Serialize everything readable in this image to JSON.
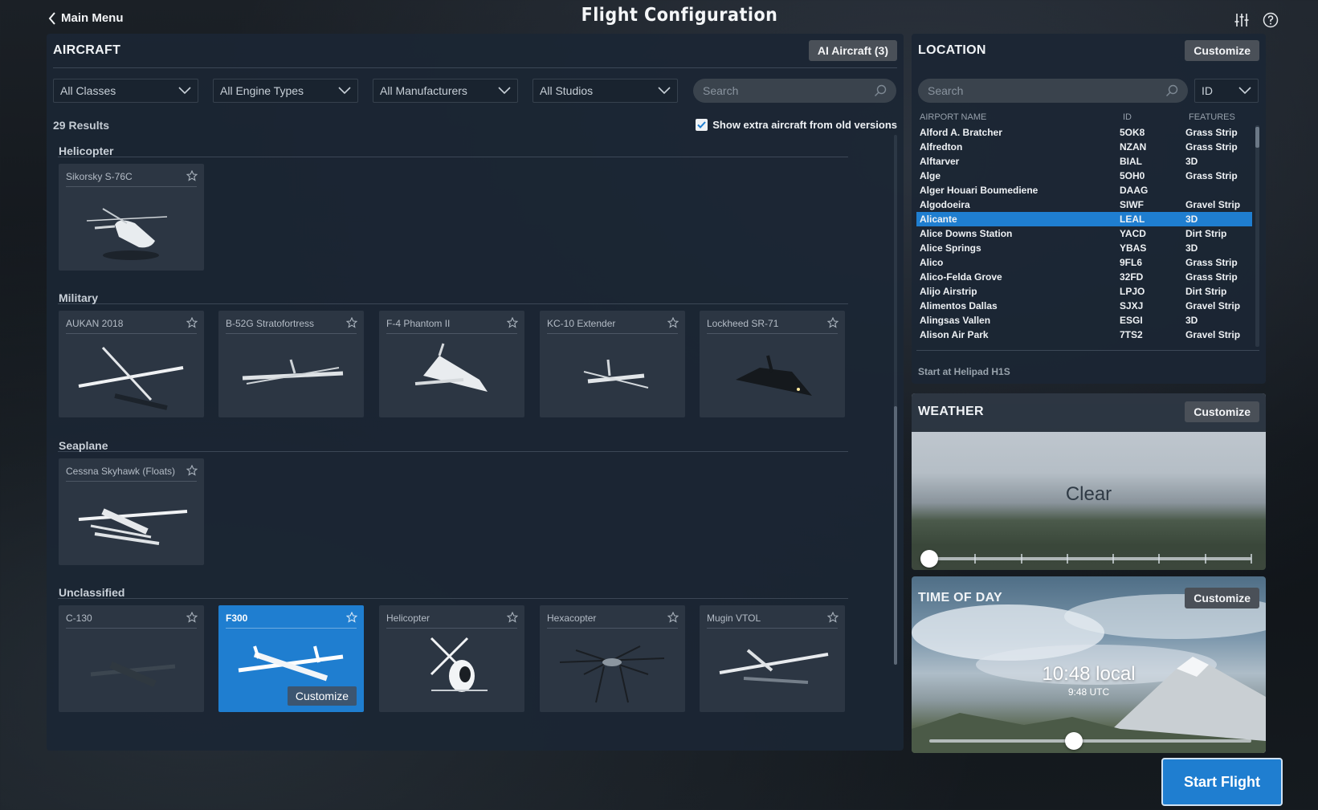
{
  "header": {
    "back_label": "Main Menu",
    "title": "Flight Configuration"
  },
  "aircraft": {
    "title": "AIRCRAFT",
    "ai_button": "AI Aircraft (3)",
    "filters": [
      "All Classes",
      "All Engine Types",
      "All Manufacturers",
      "All Studios"
    ],
    "search_placeholder": "Search",
    "results": "29 Results",
    "show_extra_label": "Show extra aircraft from old versions",
    "show_extra_checked": true,
    "categories": [
      {
        "name": "Helicopter",
        "items": [
          "Sikorsky S-76C"
        ]
      },
      {
        "name": "Military",
        "items": [
          "AUKAN 2018",
          "B-52G Stratofortress",
          "F-4 Phantom II",
          "KC-10 Extender",
          "Lockheed SR-71"
        ]
      },
      {
        "name": "Seaplane",
        "items": [
          "Cessna Skyhawk (Floats)"
        ]
      },
      {
        "name": "Unclassified",
        "items": [
          "C-130",
          "F300",
          "Helicopter",
          "Hexacopter",
          "Mugin VTOL"
        ]
      }
    ],
    "selected": "F300",
    "customize_label": "Customize"
  },
  "location": {
    "title": "LOCATION",
    "customize_label": "Customize",
    "search_placeholder": "Search",
    "id_select": "ID",
    "columns": [
      "AIRPORT NAME",
      "ID",
      "FEATURES"
    ],
    "rows": [
      [
        "Alford A. Bratcher",
        "5OK8",
        "Grass Strip"
      ],
      [
        "Alfredton",
        "NZAN",
        "Grass Strip"
      ],
      [
        "Alftarver",
        "BIAL",
        "3D"
      ],
      [
        "Alge",
        "5OH0",
        "Grass Strip"
      ],
      [
        "Alger Houari Boumediene",
        "DAAG",
        ""
      ],
      [
        "Algodoeira",
        "SIWF",
        "Gravel Strip"
      ],
      [
        "Alicante",
        "LEAL",
        "3D"
      ],
      [
        "Alice Downs Station",
        "YACD",
        "Dirt Strip"
      ],
      [
        "Alice Springs",
        "YBAS",
        "3D"
      ],
      [
        "Alico",
        "9FL6",
        "Grass Strip"
      ],
      [
        "Alico-Felda Grove",
        "32FD",
        "Grass Strip"
      ],
      [
        "Alijo Airstrip",
        "LPJO",
        "Dirt Strip"
      ],
      [
        "Alimentos Dallas",
        "SJXJ",
        "Gravel Strip"
      ],
      [
        "Alingsas Vallen",
        "ESGI",
        "3D"
      ],
      [
        "Alison Air Park",
        "7TS2",
        "Gravel Strip"
      ]
    ],
    "selected_row": 6,
    "start_at": "Start at Helipad H1S"
  },
  "weather": {
    "title": "WEATHER",
    "customize_label": "Customize",
    "value": "Clear",
    "slider_fraction": 0.0
  },
  "time_of_day": {
    "title": "TIME OF DAY",
    "customize_label": "Customize",
    "local": "10:48 local",
    "utc": "9:48 UTC",
    "slider_fraction": 0.45
  },
  "footer": {
    "start_flight": "Start Flight"
  },
  "colors": {
    "accent": "#1f7ed0",
    "panel": "#1b2634"
  }
}
